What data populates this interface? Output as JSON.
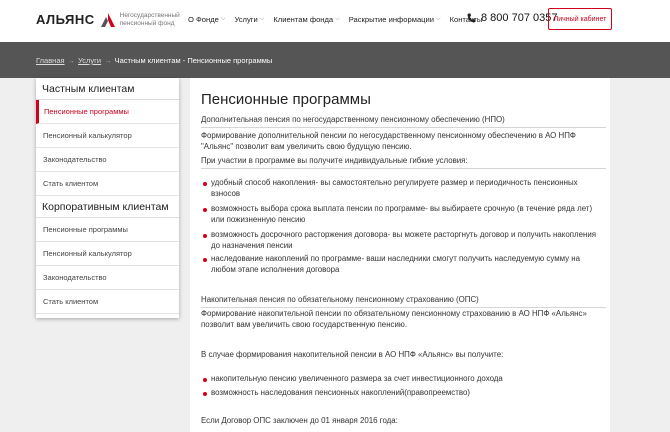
{
  "header": {
    "logo_word": "АЛЬЯНС",
    "logo_sub": "Негосударственный пенсионный фонд",
    "nav": [
      {
        "label": "О Фонде",
        "caret": true
      },
      {
        "label": "Услуги",
        "caret": true
      },
      {
        "label": "Клиентам фонда",
        "caret": true
      },
      {
        "label": "Раскрытие информации",
        "caret": true
      },
      {
        "label": "Контакты",
        "caret": false
      }
    ],
    "phone": "8 800 707 0357",
    "cabinet_label": "Личный кабинет",
    "accent": "#d0021b"
  },
  "breadcrumb": {
    "home": "Главная",
    "sep": "→",
    "services": "Услуги",
    "current": "Частным клиентам - Пенсионные программы"
  },
  "sidebar": {
    "private_title": "Частным клиентам",
    "private_items": [
      {
        "label": "Пенсионные программы",
        "active": true
      },
      {
        "label": "Пенсионный калькулятор",
        "active": false
      },
      {
        "label": "Законодательство",
        "active": false
      },
      {
        "label": "Стать клиентом",
        "active": false
      }
    ],
    "corporate_title": "Корпоративным клиентам",
    "corporate_items": [
      {
        "label": "Пенсионные программы"
      },
      {
        "label": "Пенсионный калькулятор"
      },
      {
        "label": "Законодательство"
      },
      {
        "label": "Стать клиентом"
      }
    ]
  },
  "main": {
    "title": "Пенсионные программы",
    "npo_heading": "Дополнительная пенсия по негосударственному пенсионному обеспечению (НПО)",
    "npo_intro": "Формирование дополнительной пенсии по негосударственному пенсионному обеспечению в АО НПФ \"Альянс\" позволит вам увеличить свою будущую пенсию.",
    "npo_conditions": "При участии в программе вы получите индивидуальные гибкие условия:",
    "npo_bullets": [
      "удобный способ накопления- вы самостоятельно регулируете размер и периодичность пенсионных взносов",
      "возможность выбора срока выплата пенсии по программе- вы выбираете срочную (в течение ряда лет) или пожизненную пенсию",
      "возможность досрочного расторжения договора- вы можете расторгнуть договор и получить накопления до назначения пенсии",
      "наследование накоплений по программе- ваши наследники смогут получить наследуемую сумму на любом этапе исполнения договора"
    ],
    "ops_heading": "Накопительная пенсия по обязательному пенсионному страхованию (ОПС)",
    "ops_intro": "Формирование накопительной пенсии по обязательному пенсионному страхованию в АО НПФ «Альянс» позволит вам увеличить свою государственную пенсию.",
    "ops_case": "В случае формирования накопительной пенсии в АО НПФ «Альянс» вы получите:",
    "ops_bullets": [
      "накопительную пенсию увеличенного размера за счет инвестиционного дохода",
      "возможность наследования пенсионных накоплений(правопреемство)"
    ],
    "ops_contract": "Если Договор ОПС заключен до 01 января 2016 года:"
  }
}
